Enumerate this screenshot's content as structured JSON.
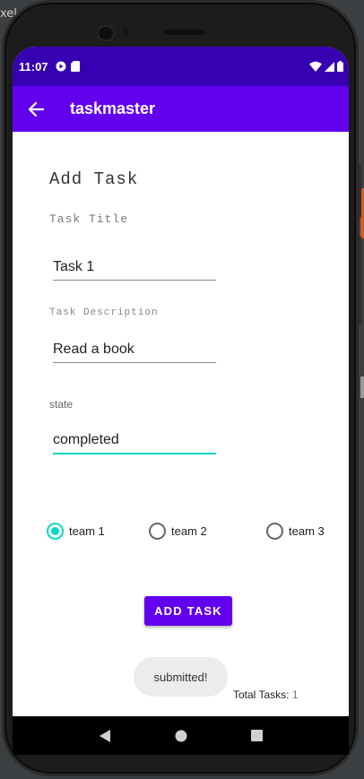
{
  "desktop": {
    "edge_text": "xel"
  },
  "status_bar": {
    "time": "11:07",
    "left_icons": [
      "play-protect-icon",
      "sd-card-icon"
    ],
    "right_icons": [
      "wifi-icon",
      "signal-icon",
      "battery-icon"
    ]
  },
  "app_bar": {
    "title": "taskmaster",
    "back_icon": "arrow-back-icon",
    "color": "#6200ee",
    "status_color": "#3700b3"
  },
  "form": {
    "heading": "Add Task",
    "title_label": "Task Title",
    "title_value": "Task 1",
    "description_label": "Task Description",
    "description_value": "Read a book",
    "state_label": "state",
    "state_value": "completed",
    "accent_color": "#03dac5"
  },
  "teams": [
    {
      "label": "team 1",
      "checked": true
    },
    {
      "label": "team 2",
      "checked": false
    },
    {
      "label": "team 3",
      "checked": false
    }
  ],
  "add_button": {
    "label": "ADD TASK"
  },
  "toast": {
    "message": "submitted!"
  },
  "footer": {
    "total_label": "Total Tasks:",
    "total_count": "1"
  },
  "nav": {
    "icons": [
      "back-triangle-icon",
      "home-circle-icon",
      "recents-square-icon"
    ]
  }
}
